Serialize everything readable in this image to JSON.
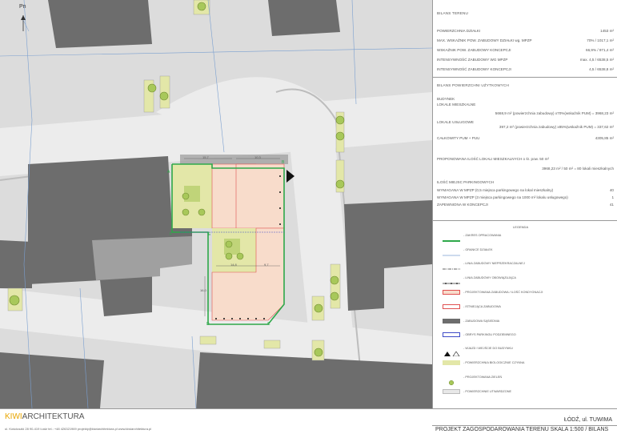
{
  "north_label": "Pn",
  "bilans": {
    "title": "BILANS TERENU",
    "rows": [
      {
        "label": "POWIERZCHNIA DZIAŁKI",
        "value": "1453 m²"
      },
      {
        "label": "MAX. WSKAŹNIK POW. ZABUDOWY DZIAŁKI wg. MPZP",
        "value": "70% / 1017,1 m²"
      },
      {
        "label": "WSKAŹNIK POW. ZABUDOWY KONCEPCJI",
        "value": "66,9% / 971,4 m²"
      },
      {
        "label": "INTENSYWNOŚĆ ZABUDOWY WG MPZP",
        "value": "max. 4,5 / 6538,5 m²"
      },
      {
        "label": "INTENSYWNOŚĆ ZABUDOWY KONCEPCJI",
        "value": "4,5 / 6538,8 m²"
      }
    ]
  },
  "usable": {
    "title": "BILANS POWIERZCHNI UŻYTKOWYCH",
    "building": "BUDYNEK",
    "residential": "LOKALE MIESZKALNE",
    "residential_calc": "5668,9 m² (powierzchnia zabudowy) x70%(wskaźnik PUM) = 3968,23 m²",
    "service": "LOKALE USŁUGOWE",
    "service_calc": "397,2 m² (powierzchnia zabudowy) x85%(wskaźnik PUM) = 337,62 m²",
    "total_label": "CAŁKOWITY PUM + PUU",
    "total_value": "4305,85 m²",
    "proposed_label": "PROPONOWANA ILOŚĆ LOKALI  MIESZKALNYCH o śr. pow. 50 m²",
    "proposed_calc": "3968,23 m² / 50 m² = 80 lokali mieszkalnych",
    "parking_title": "ILOŚĆ MIEJSC PARKINGOWYCH",
    "parking": [
      {
        "label": "WYMAGANA W MPZP (0,5 miejsca parkingowego na lokal mieszkalny)",
        "value": "40"
      },
      {
        "label": "WYMAGANA W MPZP (3 miejsca parkingowego na 1000 m² lokalu usługowego)",
        "value": "1"
      },
      {
        "label": "ZAPEWNIONA W KONCEPCJI",
        "value": "41"
      }
    ]
  },
  "legend": {
    "title": "LEGENDA",
    "items": [
      {
        "label": "- ZAKRES OPRACOWANIA",
        "kind": "green-line",
        "color": "#2ea84a"
      },
      {
        "label": "- GRANICE DZIAŁEK",
        "kind": "thin-line",
        "color": "#7a9fd0"
      },
      {
        "label": "- LINIA ZABUDOWY NIEPRZEKRACZALNEJ",
        "kind": "dash-dot",
        "color": "#333333"
      },
      {
        "label": "- LINIA ZABUDOWY OBOWIĄZUJĄCA",
        "kind": "dots",
        "color": "#333333"
      },
      {
        "label": "- PROJEKTOWANA ZABUDOWA / ILOŚĆ KONDYGNACJI",
        "kind": "fill",
        "color": "#f8dccb"
      },
      {
        "label": "- ISTNIEJĄCA ZABUDOWA",
        "kind": "red-outline",
        "color": "#e05050"
      },
      {
        "label": "- ZABUDOWA SĄSIEDNIA",
        "kind": "fill",
        "color": "#6d6d6d"
      },
      {
        "label": "- OBRYS PARKINGU PODZIEMNEGO",
        "kind": "blue-outline",
        "color": "#3f4cc8"
      },
      {
        "label": "- WJAZD I WEJŚCIE DO BUDYNKU",
        "kind": "arrows",
        "color": "#111111"
      },
      {
        "label": "- POWIERZCHNIA BIOLOGICZNIE CZYNNA",
        "kind": "fill",
        "color": "#e3e7a8"
      },
      {
        "label": "- PROJEKTOWANA ZIELEŃ",
        "kind": "tree",
        "color": "#a8c85a"
      },
      {
        "label": "- POWIERZCHNIE UTWARDZONE",
        "kind": "fill",
        "color": "#e8e8e8"
      }
    ]
  },
  "map_labels": {
    "dim_top": "15,7",
    "dim_top2": "10,3",
    "dim_mid": "14,8",
    "dim_mid2": "9,7",
    "dim_left": "16,0",
    "pt_a": "A",
    "pt_b": "B",
    "pt_c": "C",
    "pt_d": "D",
    "pt_e": "E",
    "pt_f": "F"
  },
  "footer": {
    "brand_a": "KIWI",
    "brand_b": "ARCHITEKTURA",
    "contact": "ul. Kościuszki 28 90-419 Łódź     tel.: +48 426321969     projekty@kiwiarchitektura.pl     www.kiwiarchitektura.pl",
    "city": "ŁÓDŹ, ul. TUWIMA",
    "project": "PROJEKT ZAGOSPODAROWANIA TERENU SKALA 1:500 / BILANS"
  }
}
